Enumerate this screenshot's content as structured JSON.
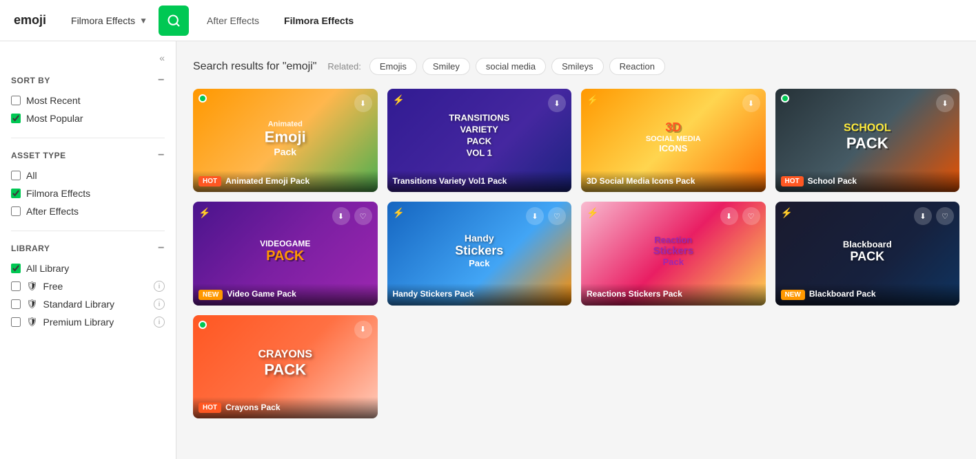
{
  "header": {
    "logo": "emoji",
    "dropdown_label": "Filmora Effects",
    "search_button_label": "🔍",
    "tabs": [
      {
        "id": "after-effects",
        "label": "After Effects",
        "active": false
      },
      {
        "id": "filmora-effects",
        "label": "Filmora Effects",
        "active": true
      }
    ]
  },
  "sidebar": {
    "collapse_icon": "«",
    "sort_by": {
      "title": "SORT BY",
      "options": [
        {
          "id": "most-recent",
          "label": "Most Recent",
          "checked": false
        },
        {
          "id": "most-popular",
          "label": "Most Popular",
          "checked": true
        }
      ]
    },
    "asset_type": {
      "title": "ASSET TYPE",
      "options": [
        {
          "id": "all",
          "label": "All",
          "checked": false
        },
        {
          "id": "filmora-effects",
          "label": "Filmora Effects",
          "checked": true
        },
        {
          "id": "after-effects",
          "label": "After Effects",
          "checked": false
        }
      ]
    },
    "library": {
      "title": "LIBRARY",
      "options": [
        {
          "id": "all-library",
          "label": "All Library",
          "checked": true,
          "has_shield": false,
          "has_info": false
        },
        {
          "id": "free",
          "label": "Free",
          "checked": false,
          "has_shield": true,
          "has_info": true
        },
        {
          "id": "standard-library",
          "label": "Standard Library",
          "checked": false,
          "has_shield": true,
          "has_info": true
        },
        {
          "id": "premium-library",
          "label": "Premium Library",
          "checked": false,
          "has_shield": true,
          "has_info": true
        }
      ]
    }
  },
  "main": {
    "search_results_text": "Search results for \"emoji\"",
    "related_label": "Related:",
    "related_tags": [
      {
        "id": "emojis",
        "label": "Emojis"
      },
      {
        "id": "smiley",
        "label": "Smiley"
      },
      {
        "id": "social-media",
        "label": "social media"
      },
      {
        "id": "smileys",
        "label": "Smileys"
      },
      {
        "id": "reaction",
        "label": "Reaction"
      }
    ],
    "cards": [
      {
        "id": "animated-emoji-pack",
        "title": "Animated Emoji Pack",
        "badge": "HOT",
        "badge_type": "hot",
        "has_green_dot": true,
        "has_lightning": false,
        "main_text": "Animated\nEmoji\nPack",
        "bg_class": "card-1"
      },
      {
        "id": "transitions-variety-vol1",
        "title": "Transitions Variety Vol1 Pack",
        "badge": "",
        "badge_type": "",
        "has_green_dot": false,
        "has_lightning": true,
        "main_text": "TRANSITIONS\nVARIETY\nPACK\nVOL 1",
        "bg_class": "card-2"
      },
      {
        "id": "3d-social-media-icons",
        "title": "3D Social Media Icons Pack",
        "badge": "",
        "badge_type": "",
        "has_green_dot": false,
        "has_lightning": true,
        "main_text": "3D\nSOCIAL MEDIA\nICONS",
        "bg_class": "card-3"
      },
      {
        "id": "school-pack",
        "title": "School Pack",
        "badge": "HOT",
        "badge_type": "hot",
        "has_green_dot": true,
        "has_lightning": false,
        "main_text": "SCHOOL\nPACK",
        "bg_class": "card-4"
      },
      {
        "id": "video-game-pack",
        "title": "Video Game Pack",
        "badge": "NEW",
        "badge_type": "new",
        "has_green_dot": false,
        "has_lightning": true,
        "main_text": "VIDEOGAME\nPACK",
        "bg_class": "card-5"
      },
      {
        "id": "handy-stickers-pack",
        "title": "Handy Stickers Pack",
        "badge": "",
        "badge_type": "",
        "has_green_dot": false,
        "has_lightning": true,
        "main_text": "Handy\nStickers\nPack",
        "bg_class": "card-6"
      },
      {
        "id": "reactions-stickers-pack",
        "title": "Reactions Stickers Pack",
        "badge": "",
        "badge_type": "",
        "has_green_dot": false,
        "has_lightning": true,
        "main_text": "Reaction\nStickers\nPack",
        "bg_class": "card-7"
      },
      {
        "id": "blackboard-pack",
        "title": "Blackboard Pack",
        "badge": "NEW",
        "badge_type": "new",
        "has_green_dot": false,
        "has_lightning": true,
        "main_text": "Blackboard\nPACK",
        "bg_class": "card-8"
      },
      {
        "id": "crayons-pack",
        "title": "Crayons Pack",
        "badge": "HOT",
        "badge_type": "hot",
        "has_green_dot": true,
        "has_lightning": false,
        "main_text": "CRAYONS\nPACK",
        "bg_class": "card-9"
      }
    ]
  }
}
